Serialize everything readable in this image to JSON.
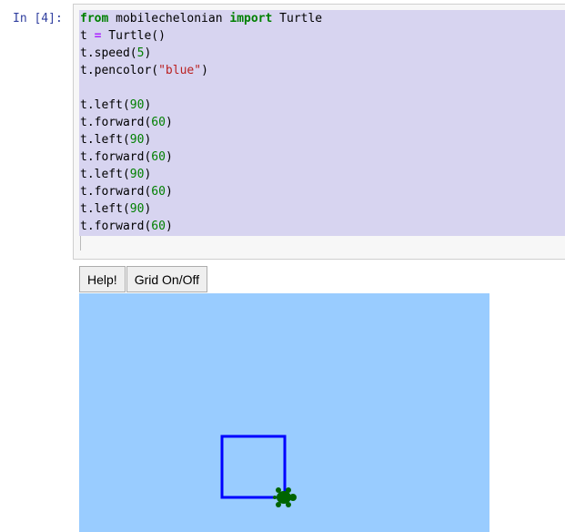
{
  "cell": {
    "prompt": "In [4]:",
    "code_lines": [
      [
        {
          "t": "from",
          "c": "kw"
        },
        {
          "t": " mobilechelonian ",
          "c": ""
        },
        {
          "t": "import",
          "c": "kw"
        },
        {
          "t": " Turtle",
          "c": ""
        }
      ],
      [
        {
          "t": "t ",
          "c": ""
        },
        {
          "t": "=",
          "c": "op"
        },
        {
          "t": " Turtle()",
          "c": ""
        }
      ],
      [
        {
          "t": "t.speed(",
          "c": ""
        },
        {
          "t": "5",
          "c": "num"
        },
        {
          "t": ")",
          "c": ""
        }
      ],
      [
        {
          "t": "t.pencolor(",
          "c": ""
        },
        {
          "t": "\"blue\"",
          "c": "str"
        },
        {
          "t": ")",
          "c": ""
        }
      ],
      [],
      [
        {
          "t": "t.left(",
          "c": ""
        },
        {
          "t": "90",
          "c": "num"
        },
        {
          "t": ")",
          "c": ""
        }
      ],
      [
        {
          "t": "t.forward(",
          "c": ""
        },
        {
          "t": "60",
          "c": "num"
        },
        {
          "t": ")",
          "c": ""
        }
      ],
      [
        {
          "t": "t.left(",
          "c": ""
        },
        {
          "t": "90",
          "c": "num"
        },
        {
          "t": ")",
          "c": ""
        }
      ],
      [
        {
          "t": "t.forward(",
          "c": ""
        },
        {
          "t": "60",
          "c": "num"
        },
        {
          "t": ")",
          "c": ""
        }
      ],
      [
        {
          "t": "t.left(",
          "c": ""
        },
        {
          "t": "90",
          "c": "num"
        },
        {
          "t": ")",
          "c": ""
        }
      ],
      [
        {
          "t": "t.forward(",
          "c": ""
        },
        {
          "t": "60",
          "c": "num"
        },
        {
          "t": ")",
          "c": ""
        }
      ],
      [
        {
          "t": "t.left(",
          "c": ""
        },
        {
          "t": "90",
          "c": "num"
        },
        {
          "t": ")",
          "c": ""
        }
      ],
      [
        {
          "t": "t.forward(",
          "c": ""
        },
        {
          "t": "60",
          "c": "num"
        },
        {
          "t": ")",
          "c": ""
        }
      ]
    ]
  },
  "widget": {
    "help_label": "Help!",
    "grid_label": "Grid On/Off"
  },
  "turtle_canvas": {
    "background": "#99ccff",
    "pen_color": "#0000ff",
    "turtle_color": "#006400",
    "turtle_icon": "turtle-icon"
  }
}
